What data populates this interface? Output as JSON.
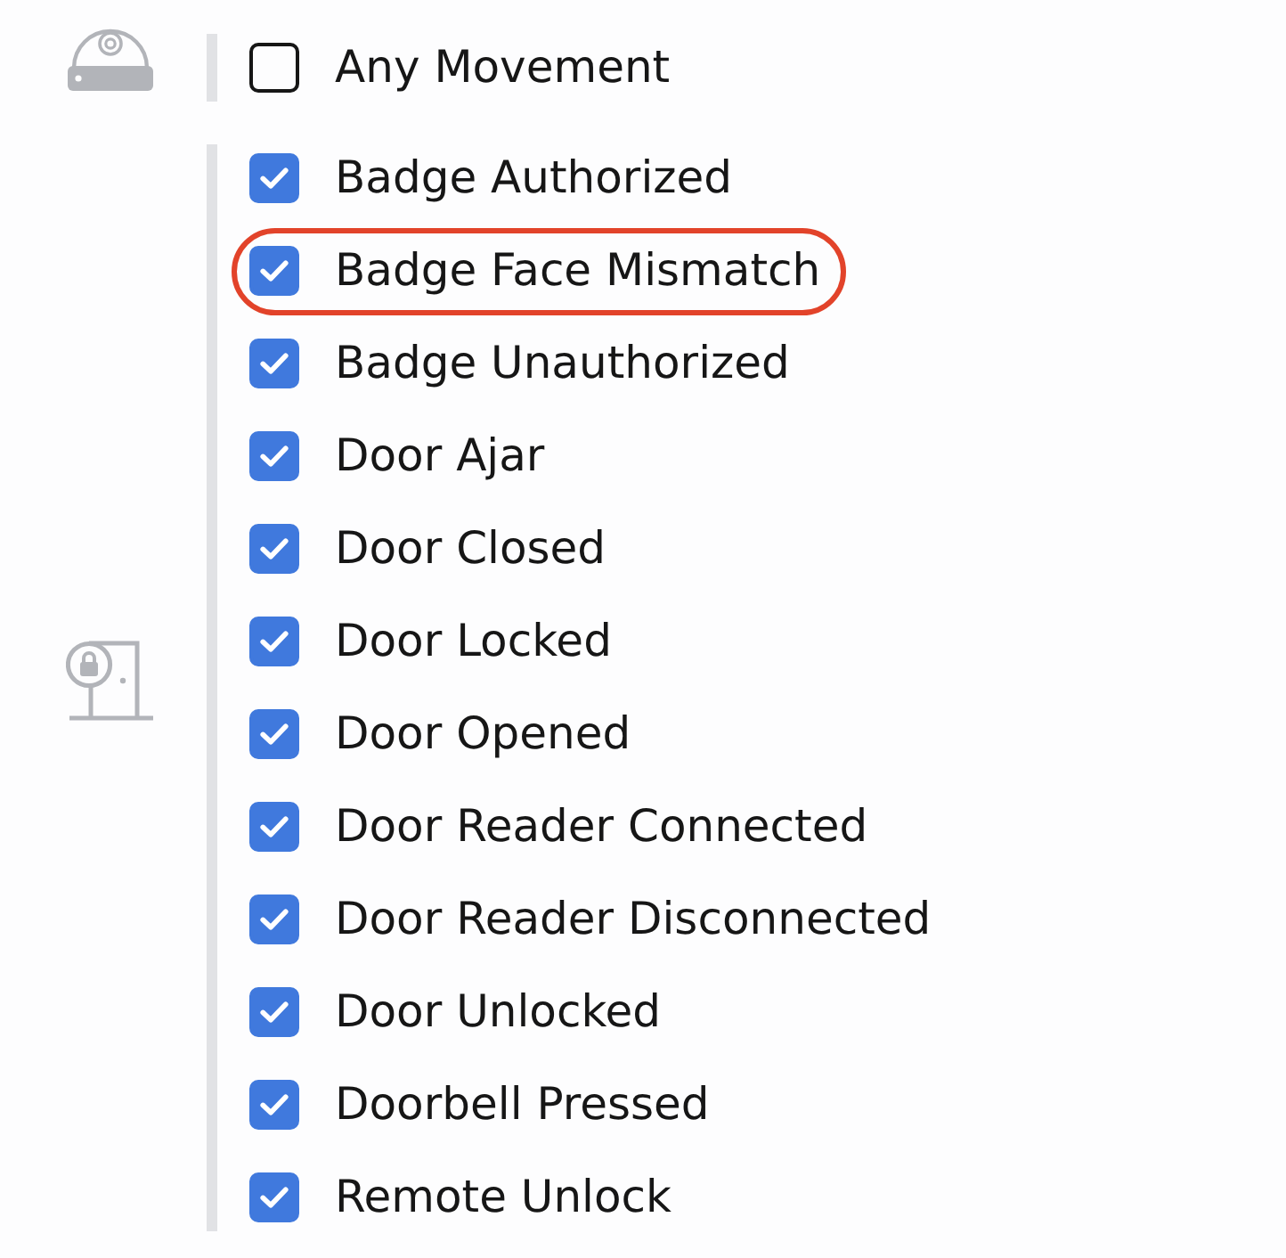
{
  "groups": [
    {
      "kind": "camera",
      "items": [
        {
          "label": "Any Movement",
          "checked": false,
          "highlighted": false
        }
      ]
    },
    {
      "kind": "door",
      "items": [
        {
          "label": "Badge Authorized",
          "checked": true,
          "highlighted": false
        },
        {
          "label": "Badge Face Mismatch",
          "checked": true,
          "highlighted": true
        },
        {
          "label": "Badge Unauthorized",
          "checked": true,
          "highlighted": false
        },
        {
          "label": "Door Ajar",
          "checked": true,
          "highlighted": false
        },
        {
          "label": "Door Closed",
          "checked": true,
          "highlighted": false
        },
        {
          "label": "Door Locked",
          "checked": true,
          "highlighted": false
        },
        {
          "label": "Door Opened",
          "checked": true,
          "highlighted": false
        },
        {
          "label": "Door Reader Connected",
          "checked": true,
          "highlighted": false
        },
        {
          "label": "Door Reader Disconnected",
          "checked": true,
          "highlighted": false
        },
        {
          "label": "Door Unlocked",
          "checked": true,
          "highlighted": false
        },
        {
          "label": "Doorbell Pressed",
          "checked": true,
          "highlighted": false
        },
        {
          "label": "Remote Unlock",
          "checked": true,
          "highlighted": false
        }
      ]
    }
  ]
}
